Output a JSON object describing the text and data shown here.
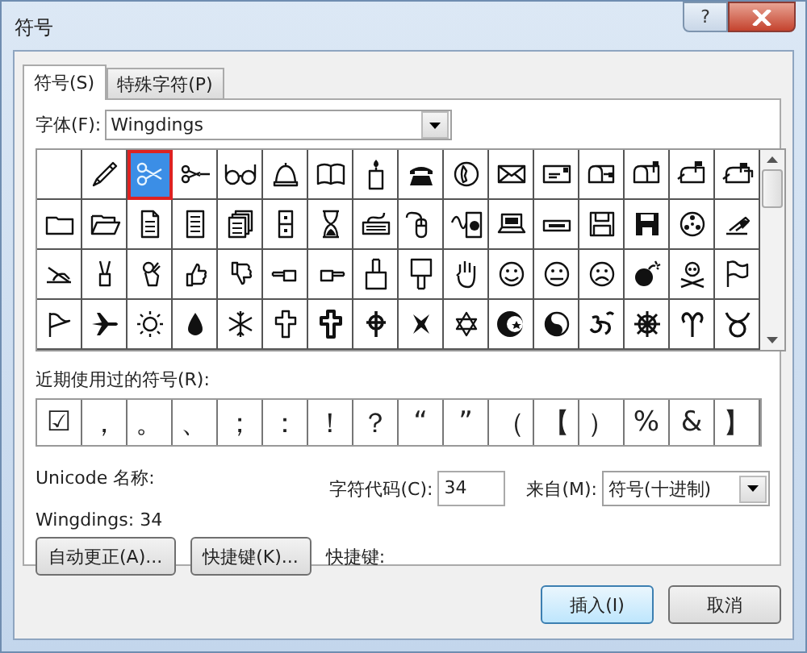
{
  "window": {
    "title": "符号",
    "help_button": "?"
  },
  "tabs": [
    {
      "label": "符号(S)",
      "selected": true
    },
    {
      "label": "特殊字符(P)",
      "selected": false
    }
  ],
  "font_field": {
    "label": "字体(F):",
    "value": "Wingdings"
  },
  "symbols": [
    {
      "selected": false
    },
    {
      "selected": false
    },
    {
      "selected": true
    },
    {
      "selected": false
    },
    {
      "selected": false
    },
    {
      "selected": false
    },
    {
      "selected": false
    },
    {
      "selected": false
    },
    {
      "selected": false
    },
    {
      "selected": false
    },
    {
      "selected": false
    },
    {
      "selected": false
    },
    {
      "selected": false
    },
    {
      "selected": false
    },
    {
      "selected": false
    },
    {
      "selected": false
    },
    {
      "selected": false
    },
    {
      "selected": false
    },
    {
      "selected": false
    },
    {
      "selected": false
    },
    {
      "selected": false
    },
    {
      "selected": false
    },
    {
      "selected": false
    },
    {
      "selected": false
    },
    {
      "selected": false
    },
    {
      "selected": false
    },
    {
      "selected": false
    },
    {
      "selected": false
    },
    {
      "selected": false
    },
    {
      "selected": false
    },
    {
      "selected": false
    },
    {
      "selected": false
    },
    {
      "selected": false
    },
    {
      "selected": false
    },
    {
      "selected": false
    },
    {
      "selected": false
    },
    {
      "selected": false
    },
    {
      "selected": false
    },
    {
      "selected": false
    },
    {
      "selected": false
    },
    {
      "selected": false
    },
    {
      "selected": false
    },
    {
      "selected": false
    },
    {
      "selected": false
    },
    {
      "selected": false
    },
    {
      "selected": false
    },
    {
      "selected": false
    },
    {
      "selected": false
    },
    {
      "selected": false
    },
    {
      "selected": false
    },
    {
      "selected": false
    },
    {
      "selected": false
    },
    {
      "selected": false
    },
    {
      "selected": false
    },
    {
      "selected": false
    },
    {
      "selected": false
    },
    {
      "selected": false
    },
    {
      "selected": false
    },
    {
      "selected": false
    },
    {
      "selected": false
    },
    {
      "selected": false
    },
    {
      "selected": false
    },
    {
      "selected": false
    },
    {
      "selected": false
    }
  ],
  "recent": {
    "label": "近期使用过的符号(R):",
    "symbols": [
      "☑",
      "，",
      "。",
      "、",
      "；",
      "：",
      "！",
      "？",
      "“",
      "”",
      "（",
      "【",
      "）",
      "%",
      "&",
      "】"
    ]
  },
  "unicode_name": {
    "label": "Unicode 名称:",
    "value": "Wingdings: 34"
  },
  "char_code": {
    "label": "字符代码(C):",
    "value": "34"
  },
  "from": {
    "label": "来自(M):",
    "value": "符号(十进制)"
  },
  "buttons": [
    "自动更正(A)...",
    "快捷键(K)..."
  ],
  "shortcut_label": "快捷键:",
  "footer_buttons": [
    "插入(I)",
    "取消"
  ]
}
